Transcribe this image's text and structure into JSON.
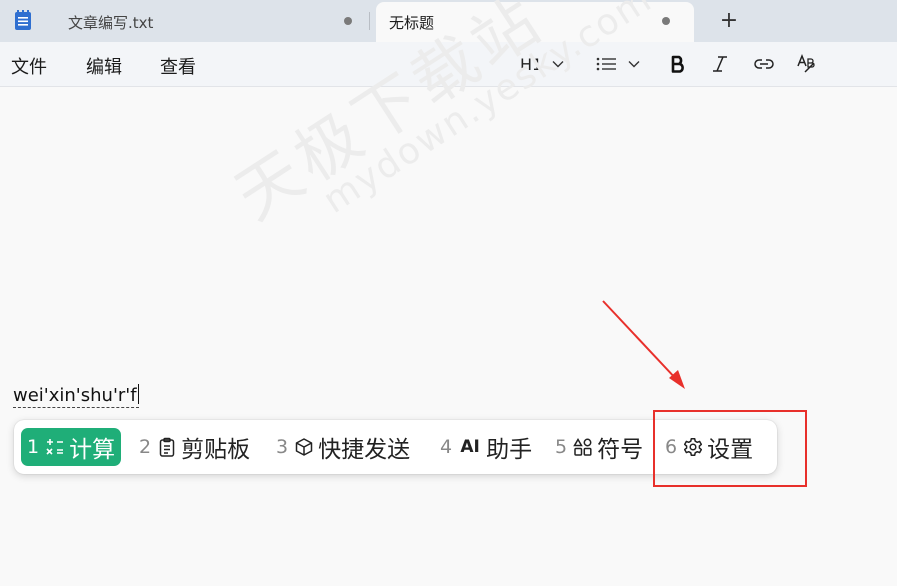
{
  "tabs": [
    {
      "title": "文章编写.txt",
      "modified": true,
      "active": false
    },
    {
      "title": "无标题",
      "modified": true,
      "active": true
    }
  ],
  "new_tab_label": "+",
  "menu": [
    "文件",
    "编辑",
    "查看"
  ],
  "toolbar": {
    "heading": "H1",
    "icons": [
      "chevron-down-icon",
      "list-icon",
      "bold-icon",
      "italic-icon",
      "link-icon",
      "spellcheck-icon"
    ]
  },
  "watermark": {
    "cn": "天极下载站",
    "url": "mydown.yesky.com"
  },
  "editor": {
    "composition": "wei'xin'shu'r'f"
  },
  "candidates": [
    {
      "num": "1",
      "label": "计算",
      "icon": "calculator-icon",
      "selected": true
    },
    {
      "num": "2",
      "label": "剪贴板",
      "icon": "clipboard-icon",
      "selected": false
    },
    {
      "num": "3",
      "label": "快捷发送",
      "icon": "cube-icon",
      "selected": false
    },
    {
      "num": "4",
      "label": "助手",
      "icon": "ai-icon",
      "icon_text": "AI",
      "selected": false
    },
    {
      "num": "5",
      "label": "符号",
      "icon": "symbols-icon",
      "selected": false
    },
    {
      "num": "6",
      "label": "设置",
      "icon": "gear-icon",
      "selected": false
    }
  ],
  "colors": {
    "accent": "#1fae78",
    "annotation": "#e8302b"
  }
}
